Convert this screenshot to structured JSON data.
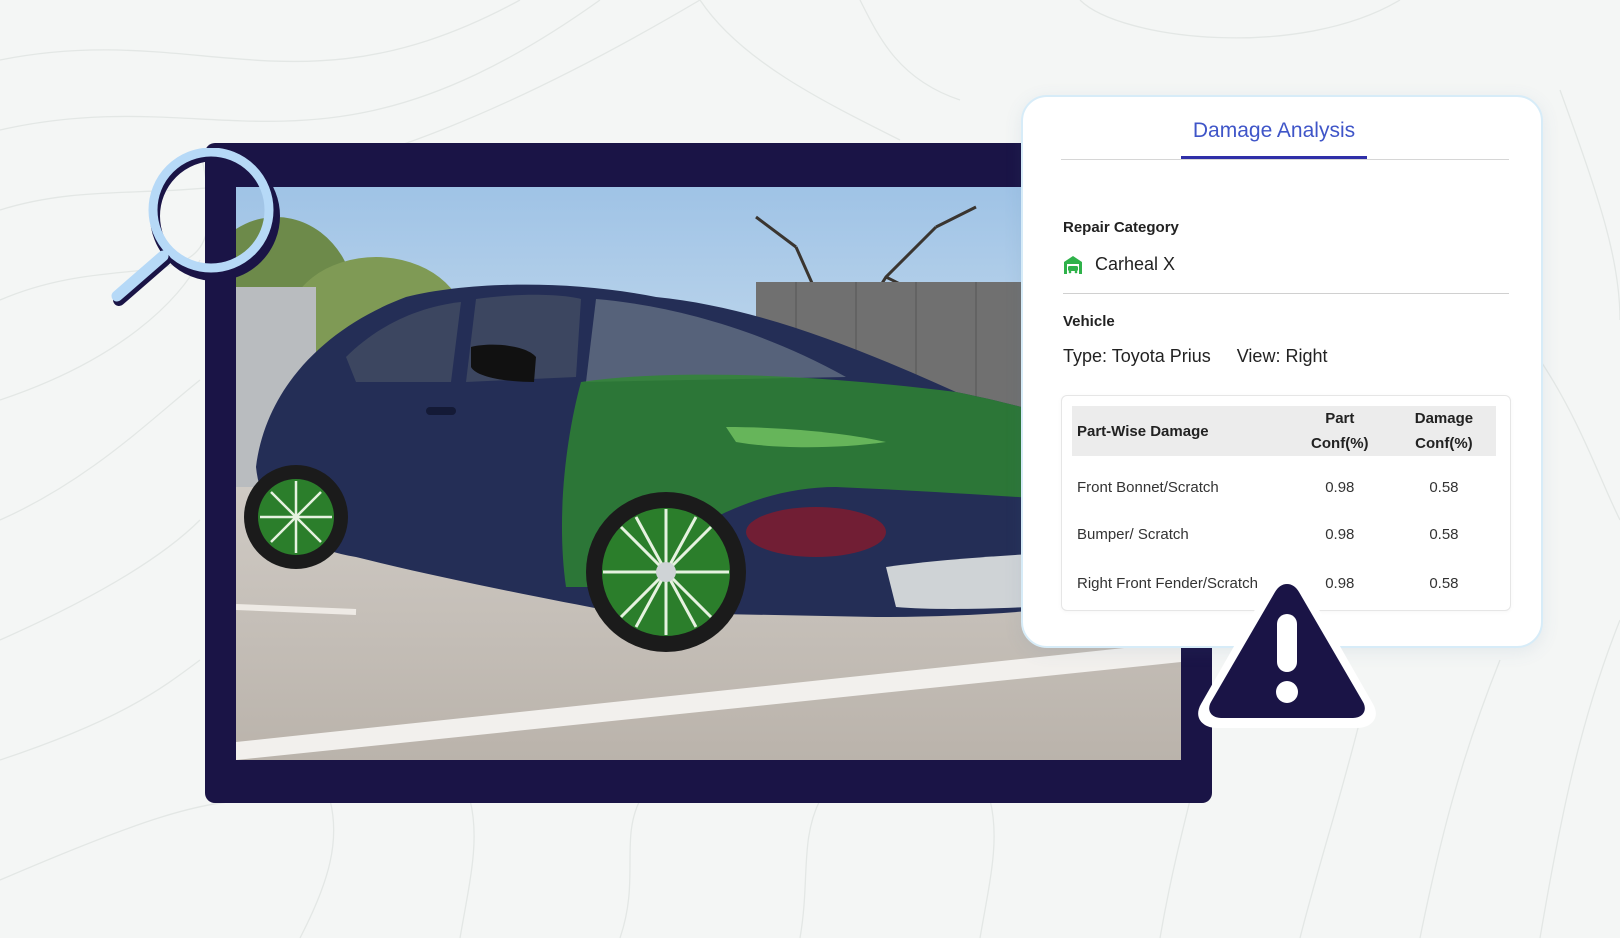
{
  "panel": {
    "active_tab": "Damage Analysis",
    "repair": {
      "label": "Repair Category",
      "name": "Carheal X",
      "icon": "garage-icon",
      "icon_color": "#2fb24a"
    },
    "vehicle": {
      "label": "Vehicle",
      "type": "Type: Toyota Prius",
      "view": "View: Right"
    },
    "table": {
      "headers": [
        "Part-Wise Damage",
        "Part Conf(%)",
        "Damage Conf(%)"
      ],
      "rows": [
        {
          "part": "Front Bonnet/Scratch",
          "part_conf": "0.98",
          "damage_conf": "0.58"
        },
        {
          "part": "Bumper/ Scratch",
          "part_conf": "0.98",
          "damage_conf": "0.58"
        },
        {
          "part": "Right Front Fender/Scratch",
          "part_conf": "0.98",
          "damage_conf": "0.58"
        }
      ]
    }
  },
  "colors": {
    "frame": "#1a1446",
    "accent_blue": "#3f55c8",
    "part_highlight": "#2e8a2e",
    "damage_highlight": "#8b1a2a"
  }
}
